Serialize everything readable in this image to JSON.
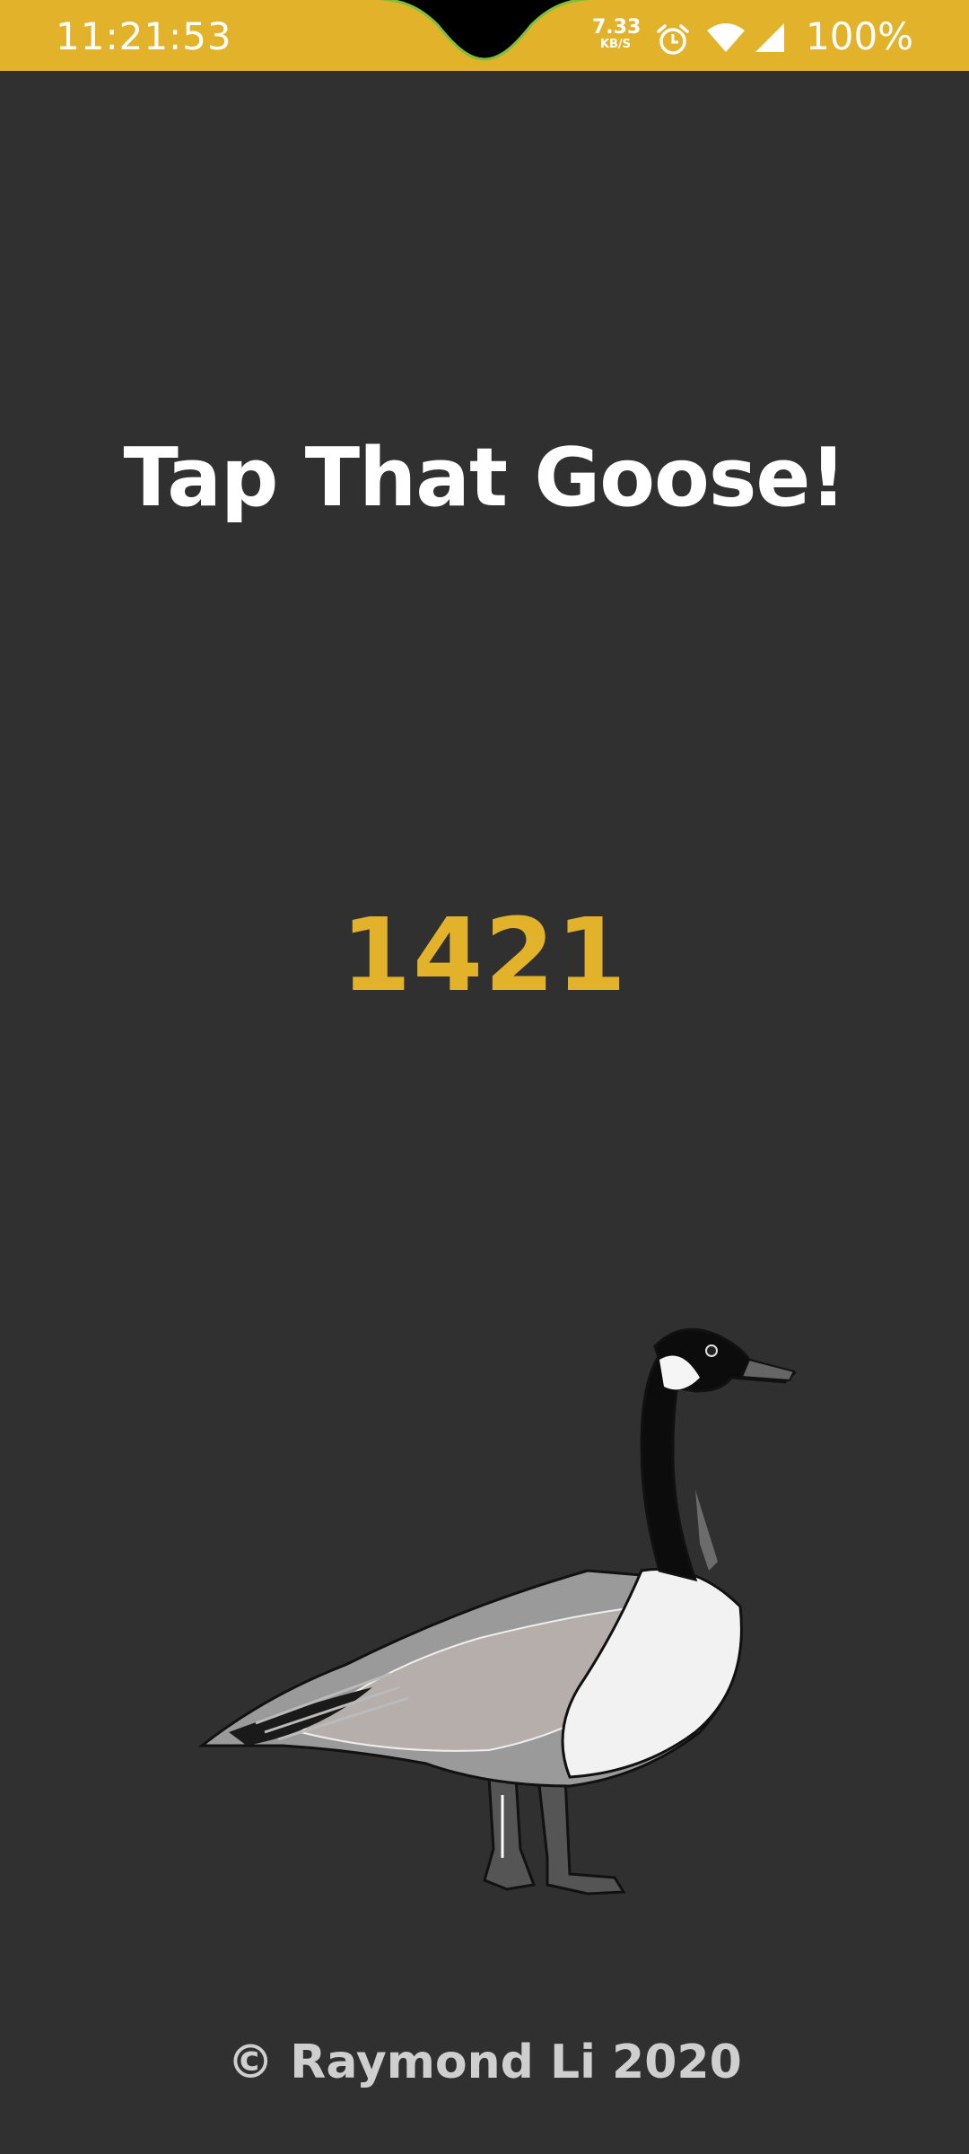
{
  "status_bar": {
    "time": "11:21:53",
    "net_speed": "7.33",
    "net_unit": "KB/S",
    "battery": "100%",
    "icons": [
      "alarm-icon",
      "wifi-icon",
      "signal-icon"
    ],
    "background": "#e3b22b"
  },
  "app": {
    "title": "Tap That Goose!",
    "counter": "1421",
    "footer": "© Raymond Li 2020",
    "accent": "#e3b22b",
    "background": "#303030"
  }
}
